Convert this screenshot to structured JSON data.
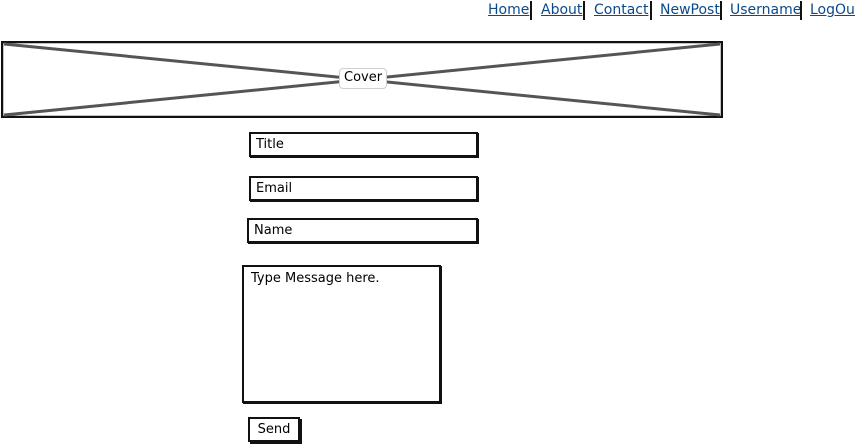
{
  "nav": {
    "items": [
      {
        "label": "Home"
      },
      {
        "label": "About"
      },
      {
        "label": "Contact"
      },
      {
        "label": "NewPost"
      },
      {
        "label": "Username"
      },
      {
        "label": "LogOut"
      }
    ]
  },
  "cover": {
    "label": "Cover"
  },
  "form": {
    "title_placeholder": "Title",
    "email_placeholder": "Email",
    "name_placeholder": "Name",
    "message_placeholder": "Type Message here.",
    "send_label": "Send"
  },
  "colors": {
    "link": "#0a4a8a",
    "border": "#111111",
    "cover_lines": "#555555"
  }
}
